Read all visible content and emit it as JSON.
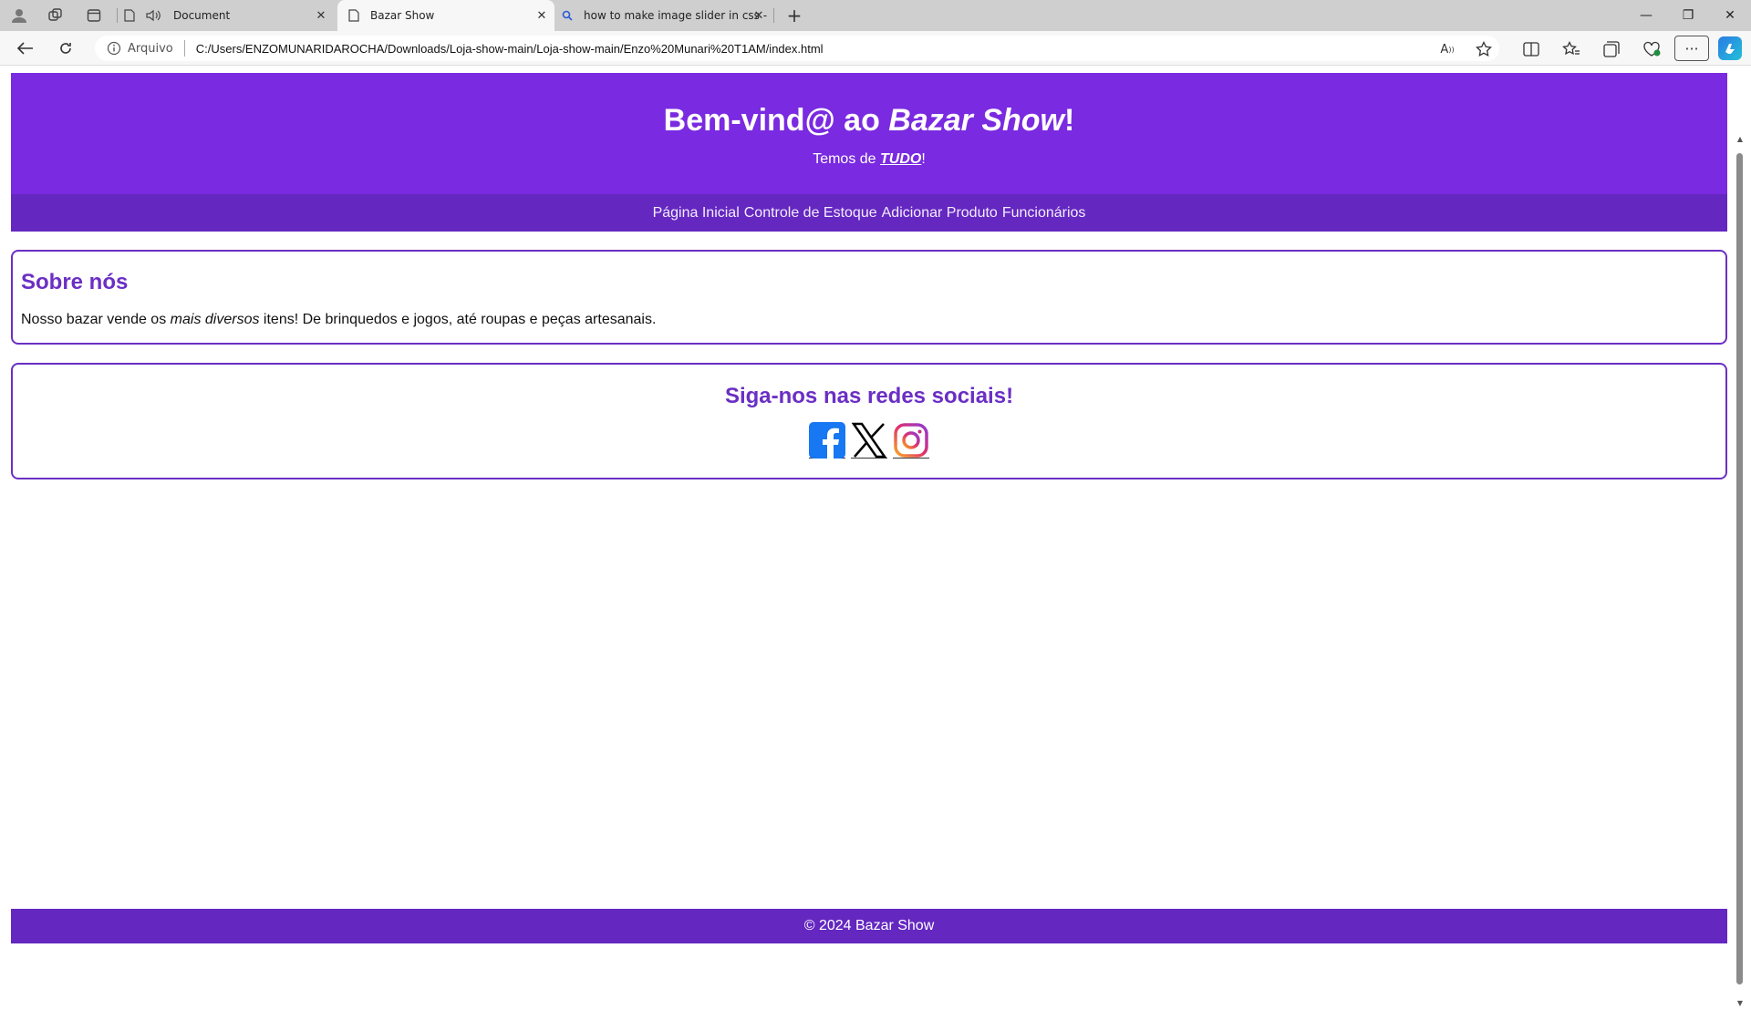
{
  "browser": {
    "tabs": [
      {
        "title": "Document",
        "icon": "page-icon"
      },
      {
        "title": "Bazar Show",
        "icon": "page-icon"
      },
      {
        "title": "how to make image slider in css -",
        "icon": "search-icon"
      }
    ],
    "address_label": "Arquivo",
    "url": "C:/Users/ENZOMUNARIDAROCHA/Downloads/Loja-show-main/Loja-show-main/Enzo%20Munari%20T1AM/index.html"
  },
  "header": {
    "title_prefix": "Bem-vind@ ao ",
    "title_brand": "Bazar Show",
    "title_suffix": "!",
    "tagline_prefix": "Temos de ",
    "tagline_link": "TUDO",
    "tagline_suffix": "!"
  },
  "nav": {
    "items": [
      "Página Inicial",
      "Controle de Estoque",
      "Adicionar Produto",
      "Funcionários"
    ]
  },
  "about": {
    "heading": "Sobre nós",
    "text_prefix": "Nosso bazar vende os ",
    "text_emph": "mais diversos",
    "text_suffix": " itens! De brinquedos e jogos, até roupas e peças artesanais."
  },
  "social": {
    "heading": "Siga-nos nas redes sociais!",
    "icons": [
      "facebook-icon",
      "x-icon",
      "instagram-icon"
    ]
  },
  "footer": {
    "text": "© 2024 Bazar Show"
  },
  "colors": {
    "header_bg": "#7a2ae0",
    "nav_bg": "#6427c0",
    "accent": "#6a2fc4"
  }
}
